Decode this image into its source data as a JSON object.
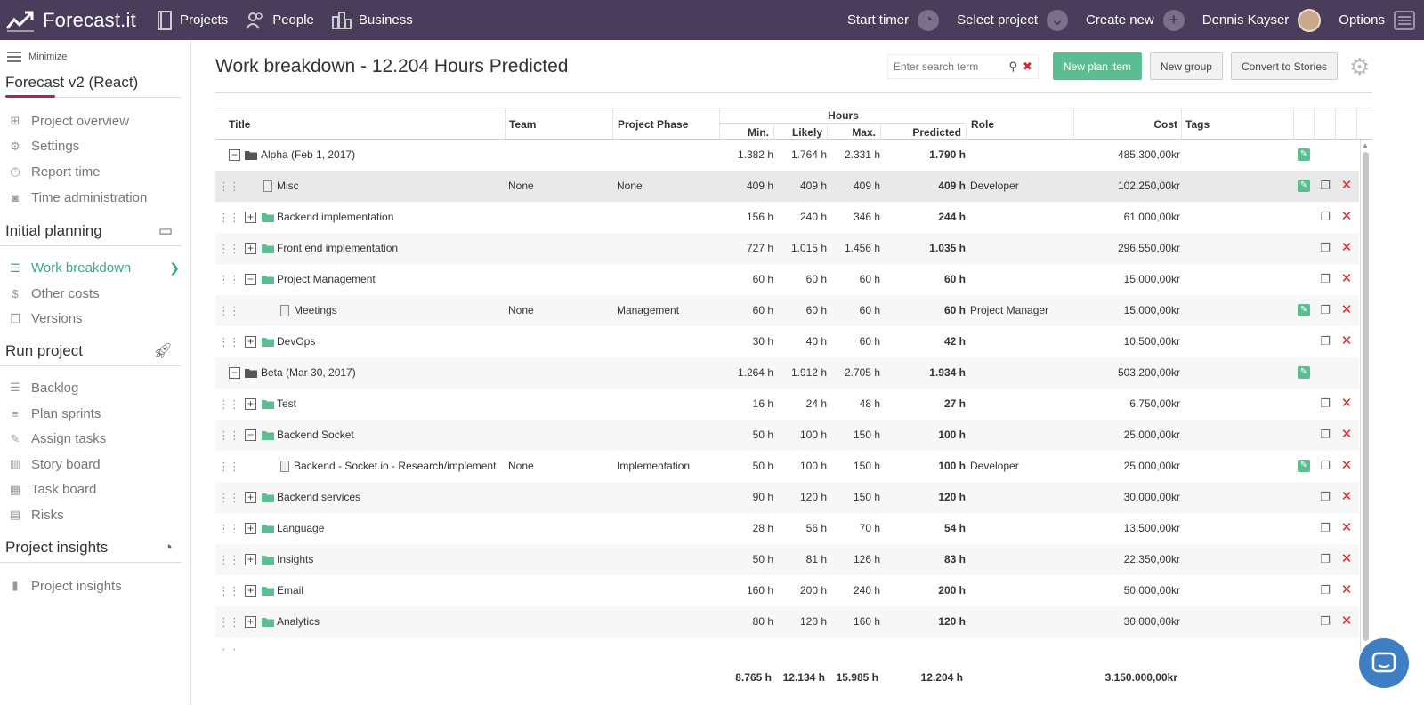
{
  "topbar": {
    "brand": "Forecast.it",
    "nav": [
      "Projects",
      "People",
      "Business"
    ],
    "start_timer": "Start timer",
    "select_project": "Select project",
    "create_new": "Create new",
    "user": "Dennis Kayser",
    "options": "Options"
  },
  "sidebar": {
    "minimize": "Minimize",
    "project_name": "Forecast v2 (React)",
    "top_items": [
      "Project overview",
      "Settings",
      "Report time",
      "Time administration"
    ],
    "section1": "Initial planning",
    "section1_items": [
      "Work breakdown",
      "Other costs",
      "Versions"
    ],
    "section2": "Run project",
    "section2_items": [
      "Backlog",
      "Plan sprints",
      "Assign tasks",
      "Story board",
      "Task board",
      "Risks"
    ],
    "section3": "Project insights",
    "section3_items": [
      "Project insights"
    ]
  },
  "header": {
    "title": "Work breakdown - 12.204 Hours Predicted",
    "search_placeholder": "Enter search term",
    "new_plan_item": "New plan item",
    "new_group": "New group",
    "convert": "Convert to Stories"
  },
  "table": {
    "columns": {
      "title": "Title",
      "team": "Team",
      "phase": "Project Phase",
      "hours": "Hours",
      "min": "Min.",
      "likely": "Likely",
      "max": "Max.",
      "predicted": "Predicted",
      "role": "Role",
      "cost": "Cost",
      "tags": "Tags"
    },
    "rows": [
      {
        "kind": "milestone",
        "level": 0,
        "toggle": "−",
        "title": "Alpha (Feb 1, 2017)",
        "team": "",
        "phase": "",
        "min": "1.382 h",
        "likely": "1.764 h",
        "max": "2.331 h",
        "predicted": "1.790 h",
        "role": "",
        "cost": "485.300,00kr",
        "edit": true,
        "copy": false,
        "del": false
      },
      {
        "kind": "item",
        "level": 1,
        "title": "Misc",
        "team": "None",
        "phase": "None",
        "min": "409 h",
        "likely": "409 h",
        "max": "409 h",
        "predicted": "409 h",
        "role": "Developer",
        "cost": "102.250,00kr",
        "edit": true,
        "copy": true,
        "del": true
      },
      {
        "kind": "group",
        "level": 1,
        "toggle": "+",
        "title": "Backend implementation",
        "team": "",
        "phase": "",
        "min": "156 h",
        "likely": "240 h",
        "max": "346 h",
        "predicted": "244 h",
        "role": "",
        "cost": "61.000,00kr",
        "edit": false,
        "copy": true,
        "del": true
      },
      {
        "kind": "group",
        "level": 1,
        "toggle": "+",
        "title": "Front end implementation",
        "team": "",
        "phase": "",
        "min": "727 h",
        "likely": "1.015 h",
        "max": "1.456 h",
        "predicted": "1.035 h",
        "role": "",
        "cost": "296.550,00kr",
        "edit": false,
        "copy": true,
        "del": true
      },
      {
        "kind": "group-open",
        "level": 1,
        "toggle": "−",
        "title": "Project Management",
        "team": "",
        "phase": "",
        "min": "60 h",
        "likely": "60 h",
        "max": "60 h",
        "predicted": "60 h",
        "role": "",
        "cost": "15.000,00kr",
        "edit": false,
        "copy": true,
        "del": true
      },
      {
        "kind": "item",
        "level": 2,
        "title": "Meetings",
        "team": "None",
        "phase": "Management",
        "min": "60 h",
        "likely": "60 h",
        "max": "60 h",
        "predicted": "60 h",
        "role": "Project Manager",
        "cost": "15.000,00kr",
        "edit": true,
        "copy": true,
        "del": true
      },
      {
        "kind": "group",
        "level": 1,
        "toggle": "+",
        "title": "DevOps",
        "team": "",
        "phase": "",
        "min": "30 h",
        "likely": "40 h",
        "max": "60 h",
        "predicted": "42 h",
        "role": "",
        "cost": "10.500,00kr",
        "edit": false,
        "copy": true,
        "del": true
      },
      {
        "kind": "milestone",
        "level": 0,
        "toggle": "−",
        "title": "Beta (Mar 30, 2017)",
        "team": "",
        "phase": "",
        "min": "1.264 h",
        "likely": "1.912 h",
        "max": "2.705 h",
        "predicted": "1.934 h",
        "role": "",
        "cost": "503.200,00kr",
        "edit": true,
        "copy": false,
        "del": false
      },
      {
        "kind": "group",
        "level": 1,
        "toggle": "+",
        "title": "Test",
        "team": "",
        "phase": "",
        "min": "16 h",
        "likely": "24 h",
        "max": "48 h",
        "predicted": "27 h",
        "role": "",
        "cost": "6.750,00kr",
        "edit": false,
        "copy": true,
        "del": true
      },
      {
        "kind": "group-open",
        "level": 1,
        "toggle": "−",
        "title": "Backend Socket",
        "team": "",
        "phase": "",
        "min": "50 h",
        "likely": "100 h",
        "max": "150 h",
        "predicted": "100 h",
        "role": "",
        "cost": "25.000,00kr",
        "edit": false,
        "copy": true,
        "del": true
      },
      {
        "kind": "item",
        "level": 2,
        "title": "Backend - Socket.io - Research/implement",
        "team": "None",
        "phase": "Implementation",
        "min": "50 h",
        "likely": "100 h",
        "max": "150 h",
        "predicted": "100 h",
        "role": "Developer",
        "cost": "25.000,00kr",
        "edit": true,
        "copy": true,
        "del": true
      },
      {
        "kind": "group",
        "level": 1,
        "toggle": "+",
        "title": "Backend services",
        "team": "",
        "phase": "",
        "min": "90 h",
        "likely": "120 h",
        "max": "150 h",
        "predicted": "120 h",
        "role": "",
        "cost": "30.000,00kr",
        "edit": false,
        "copy": true,
        "del": true
      },
      {
        "kind": "group",
        "level": 1,
        "toggle": "+",
        "title": "Language",
        "team": "",
        "phase": "",
        "min": "28 h",
        "likely": "56 h",
        "max": "70 h",
        "predicted": "54 h",
        "role": "",
        "cost": "13.500,00kr",
        "edit": false,
        "copy": true,
        "del": true
      },
      {
        "kind": "group",
        "level": 1,
        "toggle": "+",
        "title": "Insights",
        "team": "",
        "phase": "",
        "min": "50 h",
        "likely": "81 h",
        "max": "126 h",
        "predicted": "83 h",
        "role": "",
        "cost": "22.350,00kr",
        "edit": false,
        "copy": true,
        "del": true
      },
      {
        "kind": "group",
        "level": 1,
        "toggle": "+",
        "title": "Email",
        "team": "",
        "phase": "",
        "min": "160 h",
        "likely": "200 h",
        "max": "240 h",
        "predicted": "200 h",
        "role": "",
        "cost": "50.000,00kr",
        "edit": false,
        "copy": true,
        "del": true
      },
      {
        "kind": "group",
        "level": 1,
        "toggle": "+",
        "title": "Analytics",
        "team": "",
        "phase": "",
        "min": "80 h",
        "likely": "120 h",
        "max": "160 h",
        "predicted": "120 h",
        "role": "",
        "cost": "30.000,00kr",
        "edit": false,
        "copy": true,
        "del": true
      }
    ],
    "totals": {
      "min": "8.765 h",
      "likely": "12.134 h",
      "max": "15.985 h",
      "predicted": "12.204 h",
      "cost": "3.150.000,00kr"
    }
  },
  "colors": {
    "topbar": "#4a3d5c",
    "accent_green": "#5cbd93",
    "delete_red": "#d9262b",
    "project_underline": "#a8255a"
  }
}
